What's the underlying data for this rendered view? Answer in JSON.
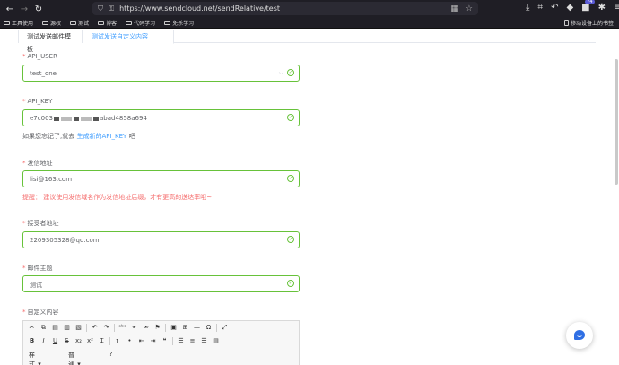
{
  "browser": {
    "url": "https://www.sendcloud.net/sendRelative/test",
    "ext_badge": "74",
    "bookmarks": [
      "工具使用",
      "源权",
      "测试",
      "博客",
      "代码学习",
      "免杀学习"
    ],
    "mobile_bookmarks": "移动设备上的书签"
  },
  "tabs": [
    {
      "label": "测试发送邮件模板",
      "active": false
    },
    {
      "label": "测试发送自定义内容",
      "active": true
    }
  ],
  "form": {
    "api_user": {
      "label": "API_USER",
      "value": "test_one"
    },
    "api_key": {
      "label": "API_KEY",
      "value_prefix": "e7c003",
      "value_suffix": "abad4858a694"
    },
    "api_key_help": {
      "text": "如果您忘记了,就去",
      "link": "生成新的API_KEY",
      "suffix": "吧"
    },
    "from": {
      "label": "发信地址",
      "value": "lisi@163.com"
    },
    "from_tip": "提醒：  建议使用发信域名作为发信地址后缀，才有更高的送达率哦~",
    "to": {
      "label": "接受者地址",
      "value": "2209305328@qq.com"
    },
    "subject": {
      "label": "邮件主题",
      "value": "测试"
    },
    "content": {
      "label": "自定义内容"
    }
  },
  "editor": {
    "style_select": "样式",
    "format_select": "普通",
    "help": "?"
  },
  "colors": {
    "success": "#67c23a",
    "primary": "#409eff",
    "danger": "#f56c6c"
  }
}
